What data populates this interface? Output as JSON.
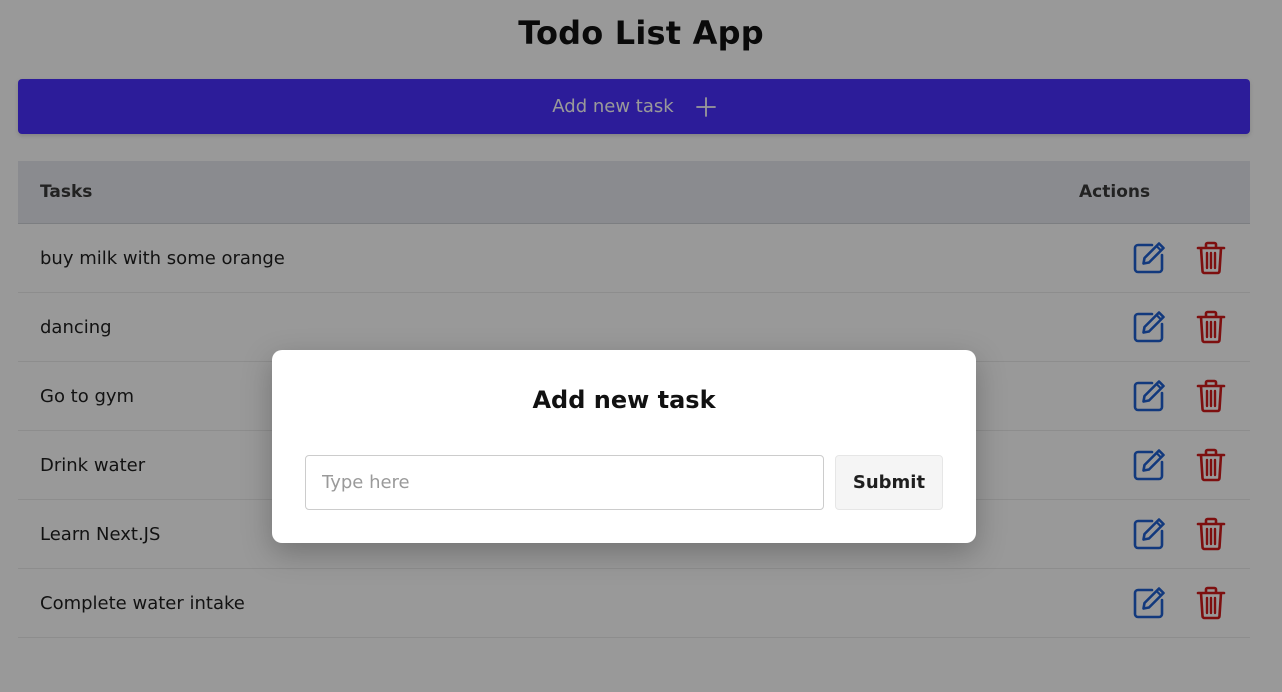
{
  "app": {
    "title": "Todo List App"
  },
  "toolbar": {
    "add_label": "Add new task",
    "add_icon": "plus-icon"
  },
  "table": {
    "headers": {
      "tasks": "Tasks",
      "actions": "Actions"
    },
    "rows": [
      {
        "task": "buy milk with some orange"
      },
      {
        "task": "dancing"
      },
      {
        "task": "Go to gym"
      },
      {
        "task": "Drink water"
      },
      {
        "task": "Learn Next.JS"
      },
      {
        "task": "Complete water intake"
      }
    ],
    "row_actions": {
      "edit_icon": "edit-icon",
      "delete_icon": "trash-icon"
    }
  },
  "modal": {
    "title": "Add new task",
    "input_placeholder": "Type here",
    "input_value": "",
    "submit_label": "Submit"
  },
  "colors": {
    "accent": "#4a2fff",
    "edit": "#1f5fd1",
    "delete": "#d11a1a",
    "header_bg": "#e6e8ee"
  }
}
